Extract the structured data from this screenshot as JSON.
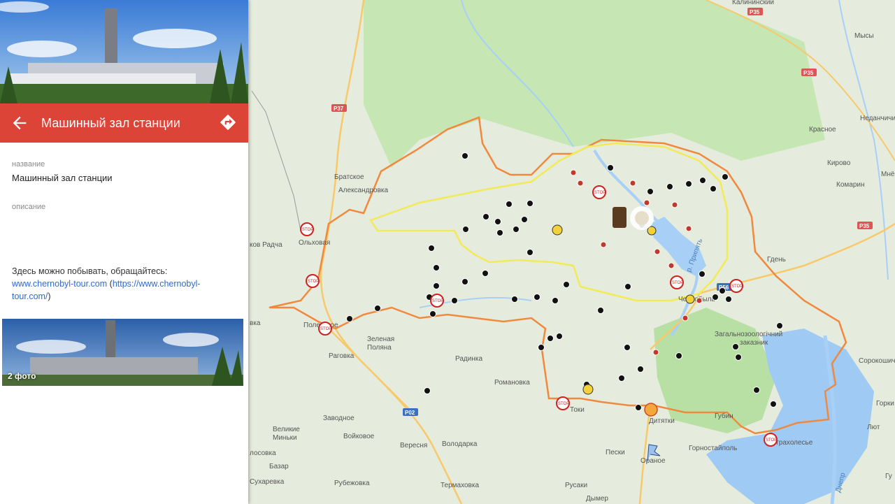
{
  "place": {
    "title": "Машинный зал станции",
    "name_label": "название",
    "name_value": "Машинный зал станции",
    "description_label": "описание",
    "description_text": "Здесь можно побывать, обращайтесь:",
    "link_text": "www.chernobyl-tour.com",
    "link_full_open": "(",
    "link_full": "https://www.chernobyl-tour.com/",
    "link_full_close": ")",
    "photo_count": "2 фото"
  },
  "map": {
    "places": [
      {
        "id": "bratskoe",
        "label": "Братское"
      },
      {
        "id": "aleksandrovka",
        "label": "Александровка"
      },
      {
        "id": "olkhovaya",
        "label": "Ольховая"
      },
      {
        "id": "radcha",
        "label": "ков Радча"
      },
      {
        "id": "polesskoe",
        "label": "Полесское"
      },
      {
        "id": "zelenaya",
        "label": "Зеленая"
      },
      {
        "id": "polyana",
        "label": "Поляна"
      },
      {
        "id": "ragovka",
        "label": "Раговка"
      },
      {
        "id": "radinka",
        "label": "Радинка"
      },
      {
        "id": "romanovka",
        "label": "Романовка"
      },
      {
        "id": "zavodnoe",
        "label": "Заводное"
      },
      {
        "id": "velikie",
        "label": "Великие"
      },
      {
        "id": "minki",
        "label": "Миньки"
      },
      {
        "id": "voikovoe",
        "label": "Войковое"
      },
      {
        "id": "veresnya",
        "label": "Вересня"
      },
      {
        "id": "volodarka",
        "label": "Володарка"
      },
      {
        "id": "lososvka",
        "label": "лосовка"
      },
      {
        "id": "bazar",
        "label": "Базар"
      },
      {
        "id": "sukharevka",
        "label": "Сухаревка"
      },
      {
        "id": "rubezhovka",
        "label": "Рубежовка"
      },
      {
        "id": "termakhovka",
        "label": "Термаховка"
      },
      {
        "id": "rusaki",
        "label": "Русаки"
      },
      {
        "id": "dymer",
        "label": "Дымер"
      },
      {
        "id": "peski",
        "label": "Пески"
      },
      {
        "id": "oranoe",
        "label": "Ораное"
      },
      {
        "id": "gornostaipol",
        "label": "Горностайполь"
      },
      {
        "id": "strakholesye",
        "label": "Страхолесье"
      },
      {
        "id": "gubin",
        "label": "Губин"
      },
      {
        "id": "dityatki",
        "label": "Дитятки"
      },
      {
        "id": "ttoki",
        "label": "Токи"
      },
      {
        "id": "chernobyl",
        "label": "Чернобыль"
      },
      {
        "id": "gden",
        "label": "Гдень"
      },
      {
        "id": "kirovo",
        "label": "Кирово"
      },
      {
        "id": "komarin",
        "label": "Комарин"
      },
      {
        "id": "krasnoe",
        "label": "Красное"
      },
      {
        "id": "mysy",
        "label": "Мысы"
      },
      {
        "id": "nedanchichi",
        "label": "Неданчичи"
      },
      {
        "id": "kalininsky",
        "label": "Калининский"
      },
      {
        "id": "sorokoshichi",
        "label": "Сорокошичи"
      },
      {
        "id": "vovka",
        "label": "вка"
      },
      {
        "id": "reserve",
        "label": "Загальнозоологічний"
      },
      {
        "id": "reserve2",
        "label": "заказник"
      },
      {
        "id": "pripyat",
        "label": "р. Припять"
      },
      {
        "id": "dnepr",
        "label": "Днепр"
      },
      {
        "id": "gorky",
        "label": "Горки"
      },
      {
        "id": "mne",
        "label": "Мнё"
      },
      {
        "id": "rubezh_right",
        "label": "Гу"
      },
      {
        "id": "luty",
        "label": "Лют"
      }
    ],
    "roads": [
      {
        "id": "p37",
        "label": "P37"
      },
      {
        "id": "p35a",
        "label": "P35"
      },
      {
        "id": "p35b",
        "label": "P35"
      },
      {
        "id": "p35c",
        "label": "P35"
      },
      {
        "id": "p56",
        "label": "P56"
      },
      {
        "id": "p02",
        "label": "P02"
      }
    ],
    "markers": [
      {
        "id": "stop",
        "label": "STOP"
      }
    ]
  }
}
